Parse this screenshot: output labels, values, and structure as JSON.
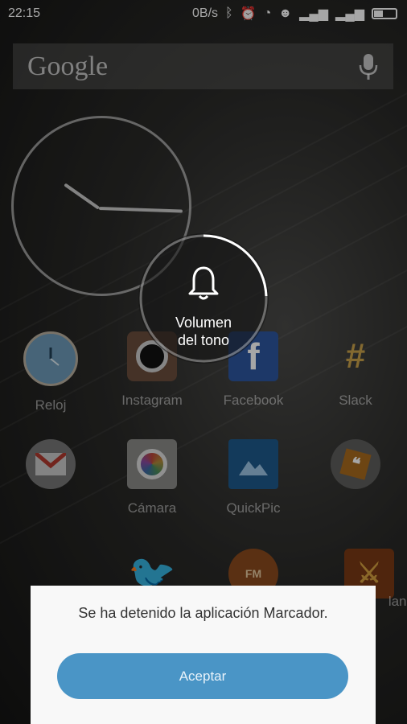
{
  "status_bar": {
    "time": "22:15",
    "net_speed": "0B/s"
  },
  "search": {
    "logo_text": "Google"
  },
  "volume_overlay": {
    "label_line1": "Volumen",
    "label_line2": "del tono",
    "level_fraction": 0.15
  },
  "apps": [
    {
      "label": "Reloj",
      "icon": "clock-app-icon"
    },
    {
      "label": "Instagram",
      "icon": "instagram-icon"
    },
    {
      "label": "Facebook",
      "icon": "facebook-icon"
    },
    {
      "label": "Slack",
      "icon": "slack-icon"
    },
    {
      "label": "",
      "icon": "gmail-icon"
    },
    {
      "label": "Cámara",
      "icon": "camera-icon"
    },
    {
      "label": "QuickPic",
      "icon": "quickpic-icon"
    },
    {
      "label": "",
      "icon": "quote-app-icon"
    },
    {
      "label": "",
      "icon": "twitter-icon"
    },
    {
      "label": "",
      "icon": "fm-radio-icon"
    },
    {
      "label": "lans",
      "icon": "clans-icon"
    }
  ],
  "dialog": {
    "message": "Se ha detenido la aplicación Marcador.",
    "button_label": "Aceptar"
  },
  "colors": {
    "accent": "#4a95c6",
    "dialog_bg": "#f8f8f8"
  }
}
